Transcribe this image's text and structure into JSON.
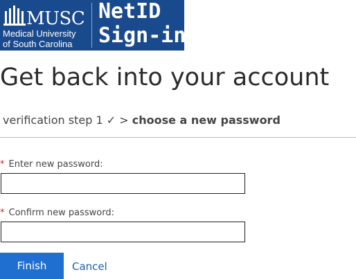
{
  "banner": {
    "logo_text": "MUSC",
    "institution_line1": "Medical University",
    "institution_line2": "of South Carolina",
    "product_line1": "NetID",
    "product_line2": "Sign-in",
    "background_color": "#1a4a8e"
  },
  "page_title": "Get back into your account",
  "steps": {
    "completed": "verification step 1 ✓",
    "separator": ">",
    "current": "choose a new password"
  },
  "form": {
    "new_password": {
      "required_marker": "*",
      "label": "Enter new password:",
      "value": ""
    },
    "confirm_password": {
      "required_marker": "*",
      "label": "Confirm new password:",
      "value": ""
    }
  },
  "actions": {
    "finish_label": "Finish",
    "cancel_label": "Cancel",
    "primary_color": "#1f6fd1"
  },
  "icons": {
    "logo": "building-columns-icon"
  }
}
